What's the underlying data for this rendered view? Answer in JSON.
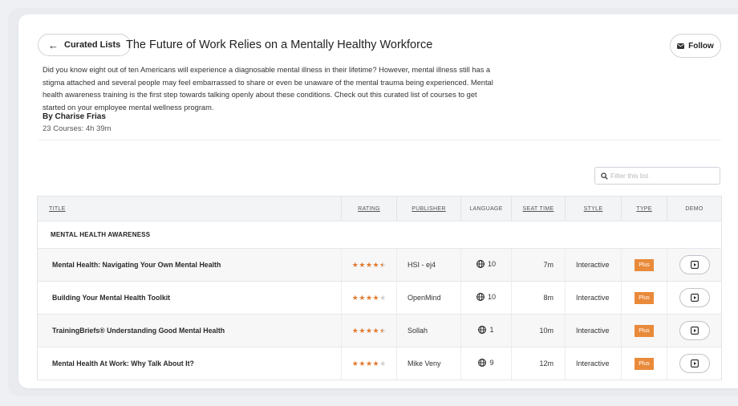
{
  "header": {
    "back_label": "Curated Lists",
    "title": "The Future of Work Relies on a Mentally Healthy Workforce",
    "follow_label": "Follow"
  },
  "description": "Did you know eight out of ten Americans will experience a diagnosable mental illness in their lifetime? However, mental illness still has a stigma attached and several people may feel embarrassed to share or even be unaware of the mental trauma being experienced. Mental health awareness training is the first step towards talking openly about these conditions. Check out this curated list of courses to get started on your employee mental wellness program.",
  "author": "By Charise Frias",
  "summary": "23 Courses: 4h 39m",
  "filter": {
    "placeholder": "Filter this list"
  },
  "table": {
    "columns": {
      "title": "TITLE",
      "rating": "RATING",
      "publisher": "PUBLISHER",
      "language": "LANGUAGE",
      "seat_time": "SEAT TIME",
      "style": "STYLE",
      "type": "TYPE",
      "demo": "DEMO"
    },
    "group": "MENTAL HEALTH AWARENESS",
    "rows": [
      {
        "title": "Mental Health: Navigating Your Own Mental Health",
        "rating": 4.5,
        "publisher": "HSI - ej4",
        "language": "10",
        "seat_time": "7m",
        "style": "Interactive",
        "type": "Plus"
      },
      {
        "title": "Building Your Mental Health Toolkit",
        "rating": 4,
        "publisher": "OpenMind",
        "language": "10",
        "seat_time": "8m",
        "style": "Interactive",
        "type": "Plus"
      },
      {
        "title": "TrainingBriefs® Understanding Good Mental Health",
        "rating": 4.5,
        "publisher": "Sollah",
        "language": "1",
        "seat_time": "10m",
        "style": "Interactive",
        "type": "Plus"
      },
      {
        "title": "Mental Health At Work: Why Talk About It?",
        "rating": 4,
        "publisher": "Mike Veny",
        "language": "9",
        "seat_time": "12m",
        "style": "Interactive",
        "type": "Plus"
      }
    ]
  },
  "colors": {
    "accent": "#e98a3a",
    "star": "#e27a2f"
  },
  "icons": {
    "back": "arrow-left-icon",
    "follow": "envelope-icon",
    "filter": "search-icon",
    "language": "globe-icon",
    "demo": "play-icon"
  }
}
